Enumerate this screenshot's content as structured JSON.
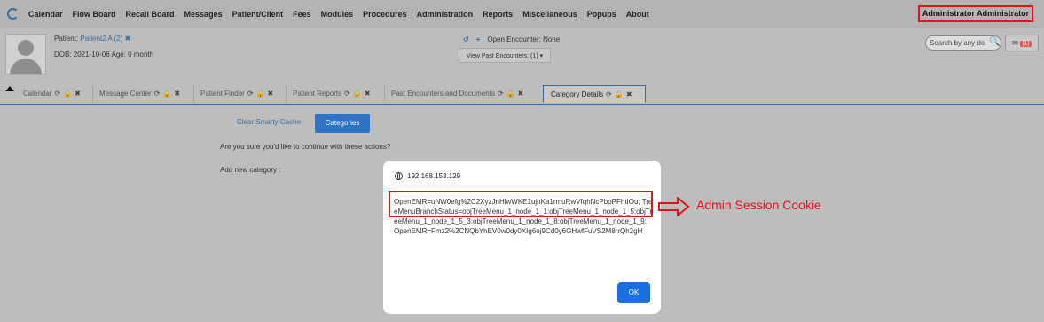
{
  "menu": [
    "Calendar",
    "Flow Board",
    "Recall Board",
    "Messages",
    "Patient/Client",
    "Fees",
    "Modules",
    "Procedures",
    "Administration",
    "Reports",
    "Miscellaneous",
    "Popups",
    "About"
  ],
  "user": "Administrator Administrator",
  "patient": {
    "label": "Patient:",
    "name": "Patient2 A (2)",
    "dob": "DOB: 2021-10-06 Age: 0 month"
  },
  "encounter": {
    "open": "Open Encounter: None",
    "past_button": "View Past Encounters: (1)"
  },
  "search": {
    "placeholder": "Search by any de"
  },
  "messages": {
    "count": "(1)"
  },
  "tabs": [
    "Calendar",
    "Message Center",
    "Patient Finder",
    "Patient Reports",
    "Past Encounters and Documents",
    "Category Details"
  ],
  "content": {
    "clear_cache": "Clear Smarty Cache",
    "categories": "Categories",
    "confirm": "Are you sure you'd like to continue with these actions?",
    "add_category": "Add new category :"
  },
  "dialog": {
    "host": "192.168.153.129",
    "message": "OpenEMR=uNW0efg%2C2XyzJnHlwWKE1ujnKa1rmuRwVfqhNcPboPFhtIOu; TreeMenuBranchStatus=objTreeMenu_1_node_1_1:objTreeMenu_1_node_1_5:objTreeMenu_1_node_1_5_3:objTreeMenu_1_node_1_8:objTreeMenu_1_node_1_9; OpenEMR=Fmz2%2CNQbYhEV0w0dy0XIg6oj9Cd0y6GHwfFuVS2M8rrQh2gH",
    "ok": "OK"
  },
  "annotation": "Admin Session Cookie",
  "colors": {
    "accent": "#2f6fa8",
    "highlight": "#e1141b",
    "ok_button": "#1a6fe0"
  }
}
